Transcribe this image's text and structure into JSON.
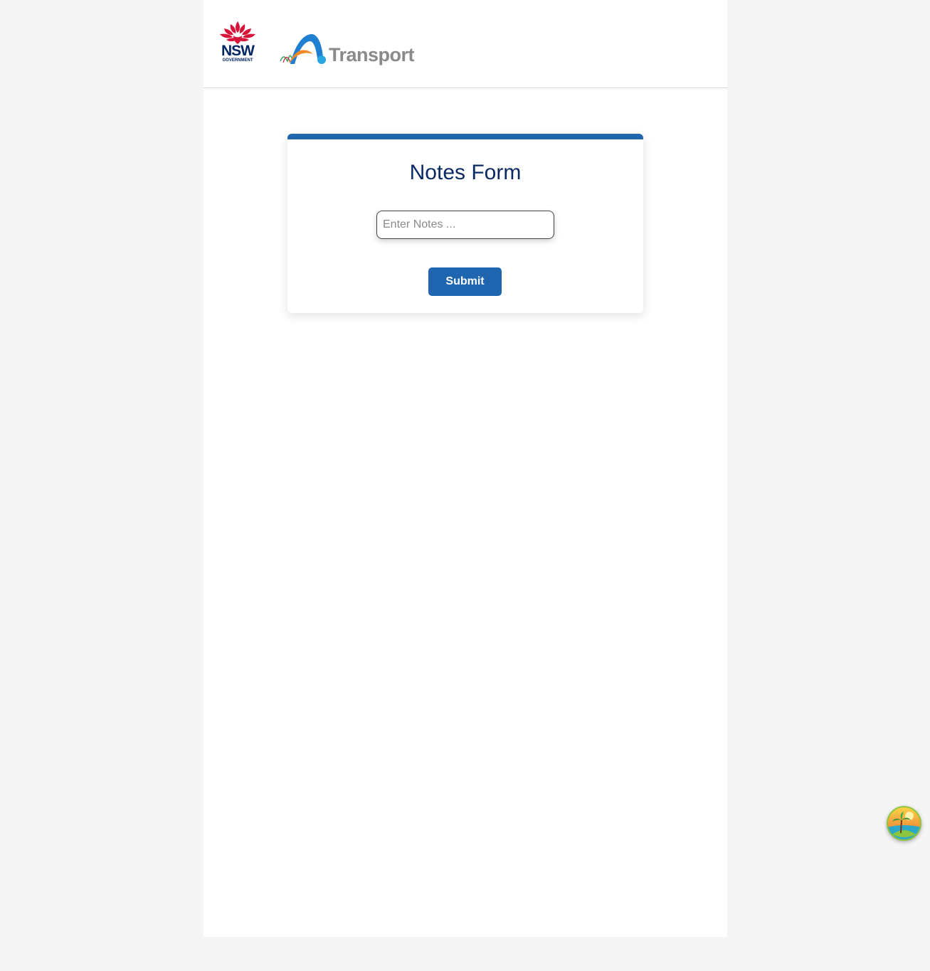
{
  "header": {
    "nsw_logo": {
      "word": "NSW",
      "sub": "GOVERNMENT",
      "icon": "waratah-icon"
    },
    "transport_logo": {
      "word": "Transport",
      "icon": "transport-arc-icon"
    }
  },
  "form": {
    "title": "Notes Form",
    "notes_input": {
      "value": "",
      "placeholder": "Enter Notes ..."
    },
    "submit_label": "Submit"
  },
  "widget": {
    "icon": "island-icon"
  },
  "colors": {
    "accent": "#1f65b0",
    "title": "#0b2a63",
    "nsw_red": "#d7153a",
    "nsw_navy": "#002664",
    "transport_gray": "#8a8a8a",
    "transport_orange": "#f08a24"
  }
}
